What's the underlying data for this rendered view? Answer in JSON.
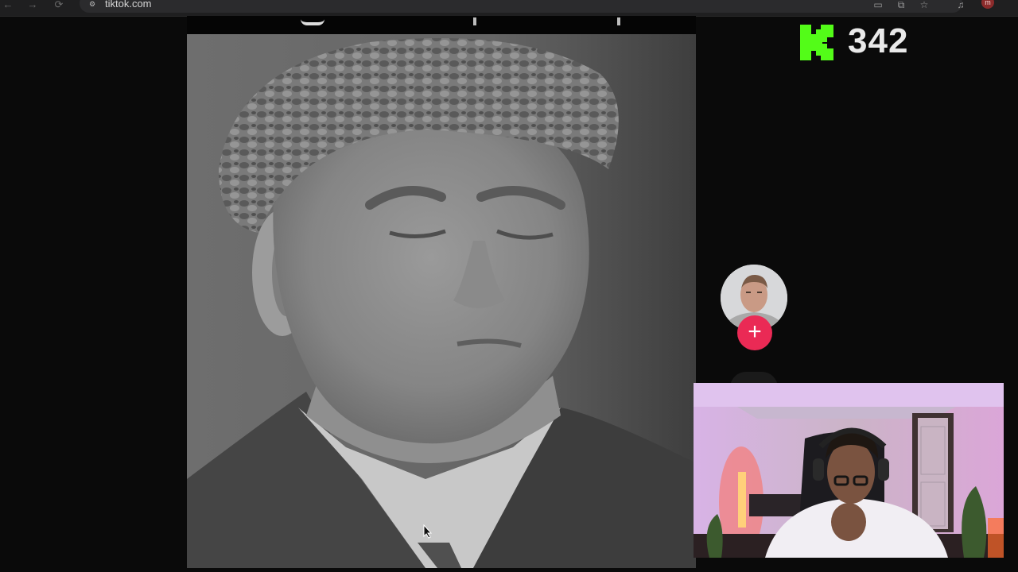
{
  "browser": {
    "url": "tiktok.com",
    "nav": {
      "back": "←",
      "forward": "→",
      "reload": "⟳"
    },
    "toolbar_icons": [
      "cast-icon",
      "translate-icon",
      "bookmark-star-icon",
      "media-icon"
    ],
    "profile_initial": "m"
  },
  "overlay": {
    "score": "342",
    "logo": "kick-logo"
  },
  "creator": {
    "follow_symbol": "+"
  },
  "colors": {
    "kick_green": "#53fc18",
    "follow_red": "#ea2a55",
    "page_bg": "#0a0a0a"
  }
}
